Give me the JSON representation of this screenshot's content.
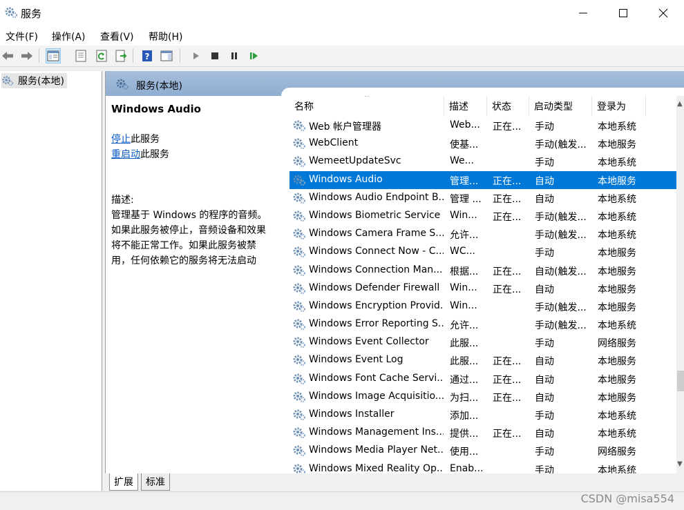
{
  "window": {
    "title": "服务",
    "app_icon": "gear-cog-icon"
  },
  "menu": [
    {
      "label": "文件(F)"
    },
    {
      "label": "操作(A)"
    },
    {
      "label": "查看(V)"
    },
    {
      "label": "帮助(H)"
    }
  ],
  "toolbar": {
    "icons": [
      "back-arrow-icon",
      "forward-arrow-icon",
      "console-tree-icon",
      "properties-icon",
      "refresh-icon",
      "export-list-icon",
      "help-icon",
      "action-pane-icon",
      "play-icon",
      "stop-icon",
      "pause-icon",
      "resume-icon"
    ]
  },
  "tree": {
    "root_label": "服务(本地)"
  },
  "main": {
    "header_title": "服务(本地)"
  },
  "details": {
    "service_name": "Windows Audio",
    "stop_link": "停止",
    "stop_suffix": "此服务",
    "restart_link": "重启动",
    "restart_suffix": "此服务",
    "desc_label": "描述:",
    "desc_lines": [
      "管理基于 Windows 的程序的音频。",
      "如果此服务被停止，音频设备和效果",
      "将不能正常工作。如果此服务被禁",
      "用，任何依赖它的服务将无法启动"
    ]
  },
  "columns": {
    "name": "名称",
    "desc": "描述",
    "status": "状态",
    "start": "启动类型",
    "logon": "登录为"
  },
  "services": [
    {
      "name": "Web 帐户管理器",
      "desc": "Web...",
      "status": "正在...",
      "start": "手动",
      "logon": "本地系统"
    },
    {
      "name": "WebClient",
      "desc": "使基...",
      "status": "",
      "start": "手动(触发...",
      "logon": "本地服务"
    },
    {
      "name": "WemeetUpdateSvc",
      "desc": "We...",
      "status": "",
      "start": "手动",
      "logon": "本地系统"
    },
    {
      "name": "Windows Audio",
      "desc": "管理...",
      "status": "正在...",
      "start": "自动",
      "logon": "本地服务",
      "selected": true
    },
    {
      "name": "Windows Audio Endpoint B...",
      "desc": "管理 ...",
      "status": "正在...",
      "start": "自动",
      "logon": "本地系统"
    },
    {
      "name": "Windows Biometric Service",
      "desc": "Win...",
      "status": "正在...",
      "start": "手动(触发...",
      "logon": "本地系统"
    },
    {
      "name": "Windows Camera Frame S...",
      "desc": "允许...",
      "status": "",
      "start": "手动(触发...",
      "logon": "本地系统"
    },
    {
      "name": "Windows Connect Now - C...",
      "desc": "WC...",
      "status": "",
      "start": "手动",
      "logon": "本地服务"
    },
    {
      "name": "Windows Connection Man...",
      "desc": "根据...",
      "status": "正在...",
      "start": "自动(触发...",
      "logon": "本地服务"
    },
    {
      "name": "Windows Defender Firewall",
      "desc": "Win...",
      "status": "正在...",
      "start": "自动",
      "logon": "本地服务"
    },
    {
      "name": "Windows Encryption Provid...",
      "desc": "Win...",
      "status": "",
      "start": "手动(触发...",
      "logon": "本地服务"
    },
    {
      "name": "Windows Error Reporting S...",
      "desc": "允许...",
      "status": "",
      "start": "手动(触发...",
      "logon": "本地系统"
    },
    {
      "name": "Windows Event Collector",
      "desc": "此服...",
      "status": "",
      "start": "手动",
      "logon": "网络服务"
    },
    {
      "name": "Windows Event Log",
      "desc": "此服...",
      "status": "正在...",
      "start": "自动",
      "logon": "本地服务"
    },
    {
      "name": "Windows Font Cache Servi...",
      "desc": "通过...",
      "status": "正在...",
      "start": "自动",
      "logon": "本地服务"
    },
    {
      "name": "Windows Image Acquisitio...",
      "desc": "为扫...",
      "status": "正在...",
      "start": "自动",
      "logon": "本地服务"
    },
    {
      "name": "Windows Installer",
      "desc": "添加...",
      "status": "",
      "start": "手动",
      "logon": "本地系统"
    },
    {
      "name": "Windows Management Ins...",
      "desc": "提供...",
      "status": "正在...",
      "start": "自动",
      "logon": "本地系统"
    },
    {
      "name": "Windows Media Player Net...",
      "desc": "使用...",
      "status": "",
      "start": "手动",
      "logon": "网络服务"
    },
    {
      "name": "Windows Mixed Reality Op...",
      "desc": "Enab...",
      "status": "",
      "start": "手动",
      "logon": "本地系统"
    }
  ],
  "tabs": [
    {
      "label": "扩展"
    },
    {
      "label": "标准"
    }
  ],
  "watermark": "CSDN @misa554",
  "colors": {
    "selection": "#0078d7",
    "header": "#9db6d8",
    "link": "#0a58c8"
  }
}
